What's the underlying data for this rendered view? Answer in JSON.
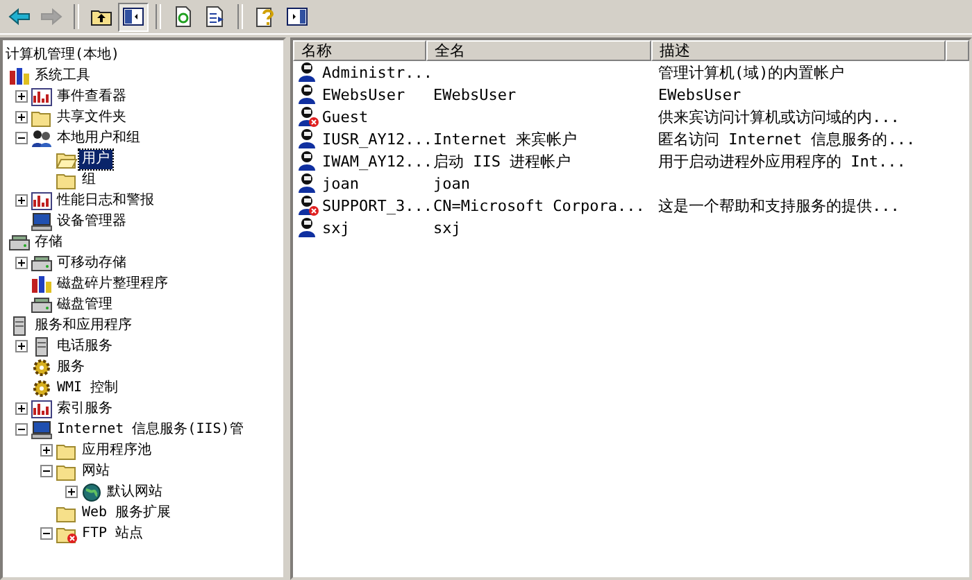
{
  "toolbar": [
    [
      {
        "kind": "back",
        "disabled": false,
        "pressed": false
      },
      {
        "kind": "forward",
        "disabled": true,
        "pressed": false
      }
    ],
    [
      {
        "kind": "up",
        "disabled": false,
        "pressed": false
      },
      {
        "kind": "tree",
        "disabled": false,
        "pressed": true
      }
    ],
    [
      {
        "kind": "refresh",
        "disabled": false,
        "pressed": false
      },
      {
        "kind": "export",
        "disabled": false,
        "pressed": false
      }
    ],
    [
      {
        "kind": "help",
        "disabled": false,
        "pressed": false
      },
      {
        "kind": "panel",
        "disabled": false,
        "pressed": false
      }
    ]
  ],
  "tree": {
    "label": "计算机管理(本地)",
    "children": [
      {
        "label": "系统工具",
        "kind": "tools",
        "selected": false,
        "children": [
          {
            "label": "事件查看器",
            "kind": "chart",
            "expanded": false,
            "selected": false
          },
          {
            "label": "共享文件夹",
            "kind": "folder",
            "expanded": false,
            "selected": false
          },
          {
            "label": "本地用户和组",
            "kind": "users",
            "expanded": true,
            "selected": false,
            "children": [
              {
                "label": "用户",
                "kind": "folder-open",
                "selected": true
              },
              {
                "label": "组",
                "kind": "folder",
                "selected": false
              }
            ]
          },
          {
            "label": "性能日志和警报",
            "kind": "chart",
            "expanded": false,
            "selected": false
          },
          {
            "label": "设备管理器",
            "kind": "computer",
            "selected": false
          }
        ]
      },
      {
        "label": "存储",
        "kind": "disk",
        "selected": false,
        "children": [
          {
            "label": "可移动存储",
            "kind": "disk",
            "expanded": false,
            "selected": false
          },
          {
            "label": "磁盘碎片整理程序",
            "kind": "tools",
            "selected": false
          },
          {
            "label": "磁盘管理",
            "kind": "disk",
            "selected": false
          }
        ]
      },
      {
        "label": "服务和应用程序",
        "kind": "server",
        "selected": false,
        "children": [
          {
            "label": "电话服务",
            "kind": "server",
            "expanded": false,
            "selected": false
          },
          {
            "label": "服务",
            "kind": "gear",
            "selected": false
          },
          {
            "label": "WMI 控制",
            "kind": "gear",
            "selected": false
          },
          {
            "label": "索引服务",
            "kind": "chart",
            "expanded": false,
            "selected": false
          },
          {
            "label": "Internet 信息服务(IIS)管",
            "kind": "computer",
            "expanded": true,
            "selected": false,
            "children": [
              {
                "label": "应用程序池",
                "kind": "folder",
                "expanded": false,
                "selected": false
              },
              {
                "label": "网站",
                "kind": "folder",
                "expanded": true,
                "selected": false,
                "children": [
                  {
                    "label": "默认网站",
                    "kind": "globe",
                    "expanded": false,
                    "selected": false
                  }
                ]
              },
              {
                "label": "Web 服务扩展",
                "kind": "folder",
                "selected": false
              },
              {
                "label": "FTP 站点",
                "kind": "folder-stop",
                "expanded": true,
                "selected": false
              }
            ]
          }
        ]
      }
    ]
  },
  "list": {
    "columns": [
      "名称",
      "全名",
      "描述"
    ],
    "rows": [
      {
        "name": "Administr...",
        "full_name": "",
        "description": "管理计算机(域)的内置帐户",
        "disabled": false
      },
      {
        "name": "EWebsUser",
        "full_name": "EWebsUser",
        "description": "EWebsUser",
        "disabled": false
      },
      {
        "name": "Guest",
        "full_name": "",
        "description": "供来宾访问计算机或访问域的内...",
        "disabled": true
      },
      {
        "name": "IUSR_AY12...",
        "full_name": "Internet 来宾帐户",
        "description": "匿名访问 Internet 信息服务的...",
        "disabled": false
      },
      {
        "name": "IWAM_AY12...",
        "full_name": "启动 IIS 进程帐户",
        "description": "用于启动进程外应用程序的 Int...",
        "disabled": false
      },
      {
        "name": "joan",
        "full_name": "joan",
        "description": "",
        "disabled": false
      },
      {
        "name": "SUPPORT_3...",
        "full_name": "CN=Microsoft Corpora...",
        "description": "这是一个帮助和支持服务的提供...",
        "disabled": true
      },
      {
        "name": "sxj",
        "full_name": "sxj",
        "description": "",
        "disabled": false
      }
    ]
  }
}
